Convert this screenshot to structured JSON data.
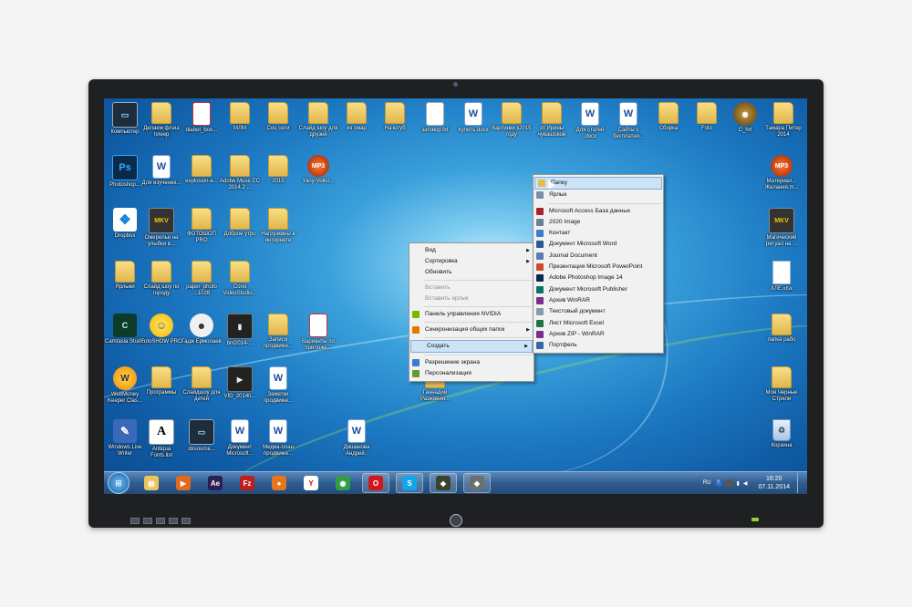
{
  "desktop_icons": [
    {
      "id": "computer",
      "label": "Компьютер",
      "icon": "monitor-icon",
      "glyph": "▭",
      "cls": "monitor"
    },
    {
      "id": "flash",
      "label": "Делаем флэш плеер",
      "icon": "folder-icon",
      "glyph": "",
      "cls": "folder"
    },
    {
      "id": "diabet",
      "label": "diabet_boo...",
      "icon": "pdf-file-icon",
      "glyph": "",
      "cls": "pdf"
    },
    {
      "id": "mlm",
      "label": "МЛМ",
      "icon": "folder-icon",
      "glyph": "",
      "cls": "folder"
    },
    {
      "id": "socseti",
      "label": "Соц сети",
      "icon": "folder-icon",
      "glyph": "",
      "cls": "folder"
    },
    {
      "id": "slideshow",
      "label": "Слайд шоу для друзей",
      "icon": "folder-icon",
      "glyph": "",
      "cls": "folder"
    },
    {
      "id": "izsmar",
      "label": "из смар",
      "icon": "folder-icon",
      "glyph": "",
      "cls": "folder"
    },
    {
      "id": "nautub",
      "label": "На ютуб",
      "icon": "folder-icon",
      "glyph": "",
      "cls": "folder"
    },
    {
      "id": "zagovor",
      "label": "заговор.txt",
      "icon": "text-file-icon",
      "glyph": "",
      "cls": "txt"
    },
    {
      "id": "kupit",
      "label": "Купить.docx",
      "icon": "word-document-icon",
      "glyph": "W",
      "cls": "word"
    },
    {
      "id": "kartinki",
      "label": "Картинки к2015 году",
      "icon": "folder-icon",
      "glyph": "",
      "cls": "folder"
    },
    {
      "id": "irina",
      "label": "от Ирины чувашовой",
      "icon": "folder-icon",
      "glyph": "",
      "cls": "folder"
    },
    {
      "id": "statey",
      "label": "Для статей .docx",
      "icon": "word-document-icon",
      "glyph": "W",
      "cls": "word"
    },
    {
      "id": "sayty",
      "label": "Сайты с бесплатно...",
      "icon": "word-document-icon",
      "glyph": "W",
      "cls": "word"
    },
    {
      "id": "sborka",
      "label": "Сборка",
      "icon": "folder-icon",
      "glyph": "",
      "cls": "folder"
    },
    {
      "id": "foto",
      "label": "Foto",
      "icon": "folder-icon",
      "glyph": "",
      "cls": "folder"
    },
    {
      "id": "chrt",
      "label": "С_hrt",
      "icon": "disc-icon",
      "glyph": "◉",
      "cls": "disc"
    },
    {
      "id": "tamara",
      "label": "Тамара Питер 2014",
      "icon": "folder-icon",
      "glyph": "",
      "cls": "folder"
    },
    {
      "id": "photoshop",
      "label": "Photoshop...",
      "icon": "photoshop-icon",
      "glyph": "Ps",
      "cls": "ps"
    },
    {
      "id": "izuchen",
      "label": "Для изучения...",
      "icon": "word-document-icon",
      "glyph": "W",
      "cls": "word"
    },
    {
      "id": "explosion",
      "label": "explosion-e...",
      "icon": "folder-icon",
      "glyph": "",
      "cls": "folder"
    },
    {
      "id": "muse",
      "label": "Adobe Muse CC 2014.2 ...",
      "icon": "folder-icon",
      "glyph": "",
      "cls": "folder"
    },
    {
      "id": "y2015",
      "label": "2015",
      "icon": "folder-icon",
      "glyph": "",
      "cls": "folder"
    },
    {
      "id": "yanyvolko",
      "label": "Yany-Volko...",
      "icon": "mp3-icon",
      "glyph": "MP3",
      "cls": "mp3"
    },
    {
      "id": "materiali",
      "label": "Материал... Желания.m...",
      "icon": "mp3-icon",
      "glyph": "MP3",
      "cls": "mp3"
    },
    {
      "id": "dropbox",
      "label": "Dropbox",
      "icon": "dropbox-icon",
      "glyph": "❖",
      "cls": "dropbox"
    },
    {
      "id": "ozherelie",
      "label": "Ожерелье на улыбки в...",
      "icon": "mkv-video-icon",
      "glyph": "MKV",
      "cls": "mkv"
    },
    {
      "id": "fotoshop",
      "label": "ФОТОШОП PRO",
      "icon": "folder-icon",
      "glyph": "",
      "cls": "folder"
    },
    {
      "id": "dobryeutro",
      "label": "Доброе утро",
      "icon": "folder-icon",
      "glyph": "",
      "cls": "folder"
    },
    {
      "id": "internet",
      "label": "Нагрузкины в интернете",
      "icon": "folder-icon",
      "glyph": "",
      "cls": "folder"
    },
    {
      "id": "magich",
      "label": "Магический ритуал на ...",
      "icon": "mkv-video-icon",
      "glyph": "MKV",
      "cls": "mkv"
    },
    {
      "id": "yarlyki",
      "label": "Ярлыки",
      "icon": "folder-icon",
      "glyph": "",
      "cls": "folder"
    },
    {
      "id": "gorodu",
      "label": "Слайд шоу по городу",
      "icon": "folder-icon",
      "glyph": "",
      "cls": "folder"
    },
    {
      "id": "paper",
      "label": "paper_photo ...1028",
      "icon": "folder-icon",
      "glyph": "",
      "cls": "folder"
    },
    {
      "id": "corel",
      "label": "Corel VideoStudio...",
      "icon": "folder-icon",
      "glyph": "",
      "cls": "folder"
    },
    {
      "id": "xlsx",
      "label": "ХЛЕ.xlsx",
      "icon": "document-icon",
      "glyph": "",
      "cls": "doc"
    },
    {
      "id": "camtasia",
      "label": "Camtasia Studio",
      "icon": "camtasia-icon",
      "glyph": "C",
      "cls": "spark"
    },
    {
      "id": "faxpro",
      "label": "FotoSHOW PRO",
      "icon": "smiley-icon",
      "glyph": "☺",
      "cls": "smile"
    },
    {
      "id": "gadzhi",
      "label": "Гадж Ермолаев",
      "icon": "penguin-icon",
      "glyph": "●",
      "cls": "penguin"
    },
    {
      "id": "bnt",
      "label": "bnt2014-...",
      "icon": "video-pdf-icon",
      "glyph": "▮",
      "cls": "film"
    },
    {
      "id": "zapis",
      "label": "Записи продвиже...",
      "icon": "folder-icon",
      "glyph": "",
      "cls": "folder"
    },
    {
      "id": "variant",
      "label": "Варианты по приложе...",
      "icon": "pdf-file-icon",
      "glyph": "",
      "cls": "pdf"
    },
    {
      "id": "papka",
      "label": "папка рабо",
      "icon": "folder-icon",
      "glyph": "",
      "cls": "folder"
    },
    {
      "id": "webmoney",
      "label": "WebMoney Keeper Clas...",
      "icon": "webmoney-icon",
      "glyph": "W",
      "cls": "chat"
    },
    {
      "id": "programmy",
      "label": "Программы",
      "icon": "folder-icon",
      "glyph": "",
      "cls": "folder"
    },
    {
      "id": "slideshowdet",
      "label": "Слайдшоу для детей",
      "icon": "folder-icon",
      "glyph": "",
      "cls": "folder"
    },
    {
      "id": "vid",
      "label": "VID_20140...",
      "icon": "video-file-icon",
      "glyph": "▶",
      "cls": "film"
    },
    {
      "id": "zametki",
      "label": "Заметки продвиже...",
      "icon": "word-document-icon",
      "glyph": "W",
      "cls": "word"
    },
    {
      "id": "genadiy",
      "label": "Геннадий Разживин...",
      "icon": "folder-icon",
      "glyph": "",
      "cls": "folder"
    },
    {
      "id": "moya",
      "label": "Моя Черные Стрели",
      "icon": "folder-icon",
      "glyph": "",
      "cls": "folder"
    },
    {
      "id": "livewriter",
      "label": "Windows Live Writer",
      "icon": "pen-icon",
      "glyph": "✎",
      "cls": "pen"
    },
    {
      "id": "fontslist",
      "label": "Antiqua Fonts.list",
      "icon": "font-file-icon",
      "glyph": "A",
      "cls": "font"
    },
    {
      "id": "dxsource",
      "label": "dxsource...",
      "icon": "monitor-icon",
      "glyph": "▭",
      "cls": "monitor"
    },
    {
      "id": "dokument",
      "label": "Документ Microsoft...",
      "icon": "word-document-icon",
      "glyph": "W",
      "cls": "word"
    },
    {
      "id": "media",
      "label": "Медиа-план продвиже...",
      "icon": "word-document-icon",
      "glyph": "W",
      "cls": "word"
    },
    {
      "id": "dvishanova",
      "label": "Дишанова Андрей..",
      "icon": "word-document-icon",
      "glyph": "W",
      "cls": "word"
    },
    {
      "id": "korzina",
      "label": "Корзина",
      "icon": "recycle-bin-icon",
      "glyph": "♻",
      "cls": "bin"
    }
  ],
  "context_menu": {
    "items": [
      {
        "label": "Вид",
        "submenu": true,
        "disabled": false,
        "icon": ""
      },
      {
        "label": "Сортировка",
        "submenu": true,
        "disabled": false,
        "icon": ""
      },
      {
        "label": "Обновить",
        "submenu": false,
        "disabled": false,
        "icon": ""
      },
      {
        "sep": true
      },
      {
        "label": "Вставить",
        "submenu": false,
        "disabled": true,
        "icon": ""
      },
      {
        "label": "Вставить ярлык",
        "submenu": false,
        "disabled": true,
        "icon": ""
      },
      {
        "sep": true
      },
      {
        "label": "Панель управления NVIDIA",
        "submenu": false,
        "disabled": false,
        "icon": "nvidia-icon"
      },
      {
        "sep": true
      },
      {
        "label": "Синхронизация общих папок",
        "submenu": true,
        "disabled": false,
        "icon": "sync-icon"
      },
      {
        "sep": true
      },
      {
        "label": "Создать",
        "submenu": true,
        "disabled": false,
        "icon": "",
        "highlighted": true
      },
      {
        "sep": true
      },
      {
        "label": "Разрешение экрана",
        "submenu": false,
        "disabled": false,
        "icon": "display-icon"
      },
      {
        "label": "Персонализация",
        "submenu": false,
        "disabled": false,
        "icon": "personalize-icon"
      }
    ]
  },
  "create_submenu": {
    "items": [
      {
        "label": "Папку",
        "icon": "folder-icon",
        "highlighted": true
      },
      {
        "label": "Ярлык",
        "icon": "shortcut-icon"
      },
      {
        "sep": true
      },
      {
        "label": "Microsoft Access База данных",
        "icon": "access-icon"
      },
      {
        "label": "2020 Image",
        "icon": "image-icon"
      },
      {
        "label": "Контакт",
        "icon": "contact-icon"
      },
      {
        "label": "Документ Microsoft Word",
        "icon": "word-icon"
      },
      {
        "label": "Journal Document",
        "icon": "journal-icon"
      },
      {
        "label": "Презентация Microsoft PowerPoint",
        "icon": "powerpoint-icon"
      },
      {
        "label": "Adobe Photoshop Image 14",
        "icon": "photoshop-icon"
      },
      {
        "label": "Документ Microsoft Publisher",
        "icon": "publisher-icon"
      },
      {
        "label": "Архив WinRAR",
        "icon": "winrar-icon"
      },
      {
        "label": "Текстовый документ",
        "icon": "text-document-icon"
      },
      {
        "label": "Лист Microsoft Excel",
        "icon": "excel-icon"
      },
      {
        "label": "Архив ZIP - WinRAR",
        "icon": "zip-icon"
      },
      {
        "label": "Портфель",
        "icon": "briefcase-icon"
      }
    ]
  },
  "taskbar": {
    "apps": [
      {
        "icon": "explorer-folder-icon",
        "glyph": "▤",
        "bg": "#e9c55a"
      },
      {
        "icon": "media-player-icon",
        "glyph": "▶",
        "bg": "#e36a1a"
      },
      {
        "icon": "after-effects-icon",
        "glyph": "Ae",
        "bg": "#2a1e52"
      },
      {
        "icon": "filezilla-icon",
        "glyph": "Fz",
        "bg": "#bf1e1e"
      },
      {
        "icon": "firefox-icon",
        "glyph": "●",
        "bg": "#e8741d"
      },
      {
        "icon": "yandex-browser-icon",
        "glyph": "Y",
        "bg": "#ffffff"
      },
      {
        "icon": "chrome-icon",
        "glyph": "◉",
        "bg": "#2f9e44"
      },
      {
        "icon": "opera-icon",
        "glyph": "O",
        "bg": "#d0161c"
      },
      {
        "icon": "skype-icon",
        "glyph": "S",
        "bg": "#12a5ec"
      },
      {
        "icon": "camtasia-recorder-icon",
        "glyph": "◆",
        "bg": "#37442d"
      },
      {
        "icon": "camtasia-studio-icon",
        "glyph": "◆",
        "bg": "#6a6f72"
      }
    ],
    "lang": "RU",
    "time": "16:20",
    "date": "07.11.2014"
  },
  "colors": {
    "accent": "#1c79c2",
    "menu_highlight": "#cde3f6"
  }
}
